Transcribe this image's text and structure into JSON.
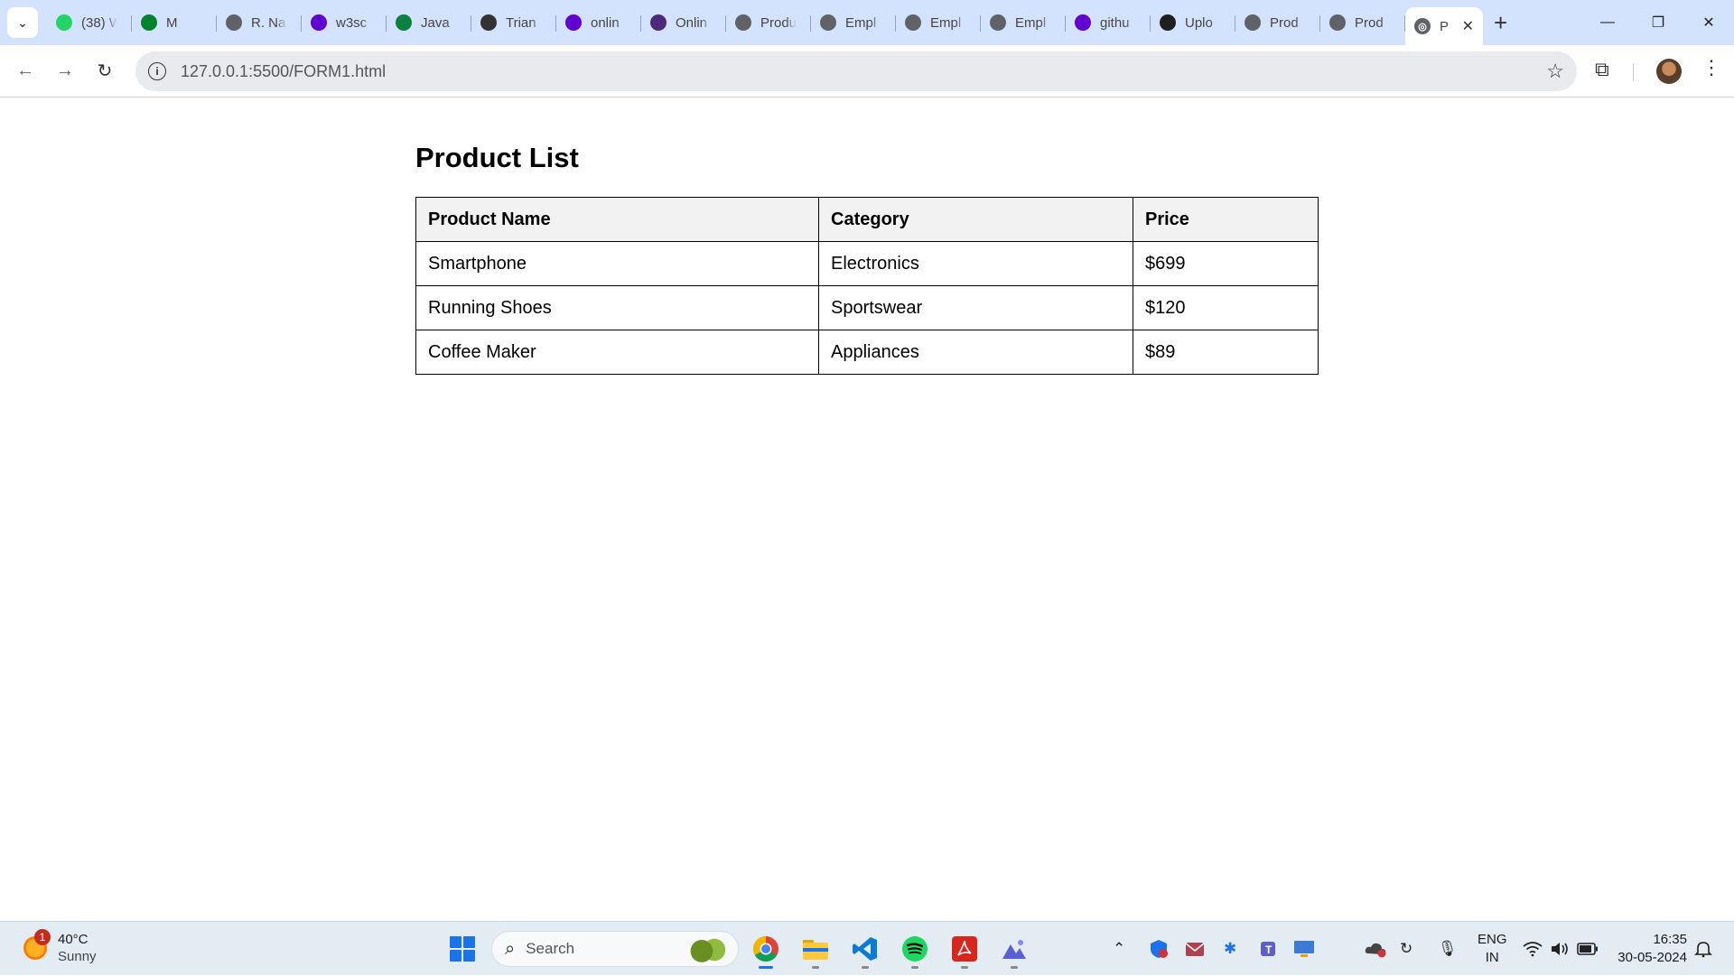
{
  "browser": {
    "tabs": [
      {
        "title": "(38) W",
        "icon": "whatsapp-icon",
        "color": "#25d366"
      },
      {
        "title": "M",
        "icon": "meet-icon",
        "color": "#00832d"
      },
      {
        "title": "R. Na",
        "icon": "globe-icon",
        "color": "#5f6368"
      },
      {
        "title": "w3sc",
        "icon": "yahoo-icon",
        "color": "#6001d2"
      },
      {
        "title": "Java",
        "icon": "w-icon",
        "color": "#0b8043"
      },
      {
        "title": "Trian",
        "icon": "openai-icon",
        "color": "#333333"
      },
      {
        "title": "onlin",
        "icon": "yahoo-icon",
        "color": "#6001d2"
      },
      {
        "title": "Onlin",
        "icon": "bolt-icon",
        "color": "#4b2a7c"
      },
      {
        "title": "Produ",
        "icon": "globe-icon",
        "color": "#5f6368"
      },
      {
        "title": "Empl",
        "icon": "globe-icon",
        "color": "#5f6368"
      },
      {
        "title": "Empl",
        "icon": "globe-icon",
        "color": "#5f6368"
      },
      {
        "title": "Empl",
        "icon": "globe-icon",
        "color": "#5f6368"
      },
      {
        "title": "githu",
        "icon": "yahoo-icon",
        "color": "#6001d2"
      },
      {
        "title": "Uplo",
        "icon": "github-icon",
        "color": "#1f1f1f"
      },
      {
        "title": "Prod",
        "icon": "globe-icon",
        "color": "#5f6368"
      },
      {
        "title": "Prod",
        "icon": "globe-icon",
        "color": "#5f6368"
      }
    ],
    "active_tab": {
      "title": "P",
      "icon": "globe-icon"
    },
    "url": "127.0.0.1:5500/FORM1.html"
  },
  "page": {
    "title": "Product List",
    "table": {
      "headers": [
        "Product Name",
        "Category",
        "Price"
      ],
      "rows": [
        [
          "Smartphone",
          "Electronics",
          "$699"
        ],
        [
          "Running Shoes",
          "Sportswear",
          "$120"
        ],
        [
          "Coffee Maker",
          "Appliances",
          "$89"
        ]
      ]
    }
  },
  "taskbar": {
    "weather": {
      "temp": "40°C",
      "condition": "Sunny",
      "badge": "1"
    },
    "search_label": "Search",
    "language": {
      "line1": "ENG",
      "line2": "IN"
    },
    "clock": {
      "time": "16:35",
      "date": "30-05-2024"
    }
  }
}
